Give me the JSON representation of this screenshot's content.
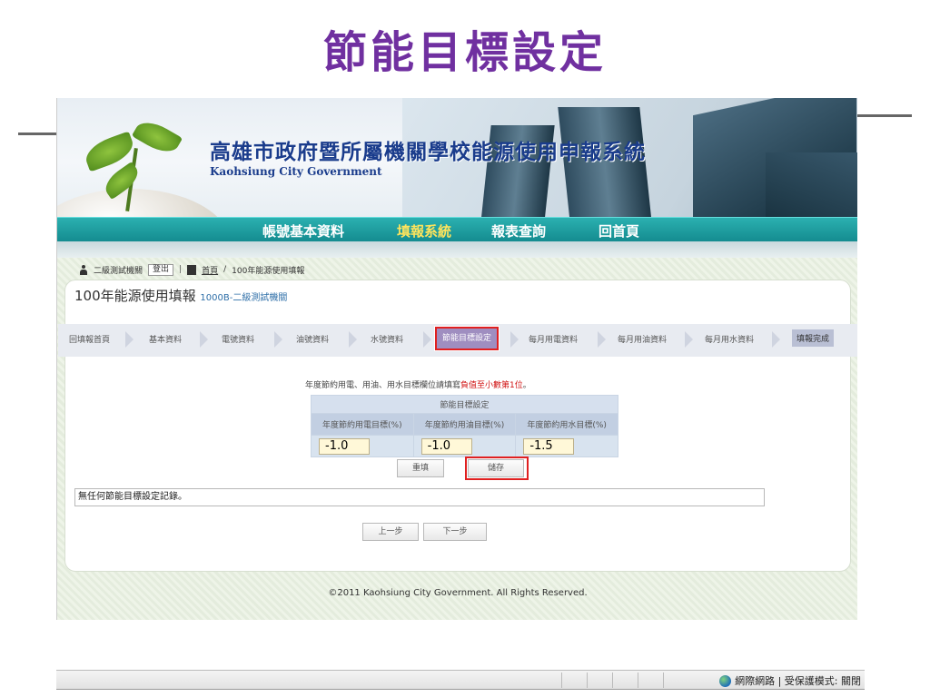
{
  "slide": {
    "title": "節能目標設定"
  },
  "banner": {
    "title": "高雄市政府暨所屬機關學校能源使用申報系統",
    "subtitle": "Kaohsiung City Government"
  },
  "nav": {
    "items": [
      {
        "label": "帳號基本資料"
      },
      {
        "label": "填報系統"
      },
      {
        "label": "報表查詢"
      },
      {
        "label": "回首頁"
      }
    ]
  },
  "userbar": {
    "user": "二級測試機關",
    "logout": "登出",
    "home": "首頁",
    "separator": "/",
    "crumb": "100年能源使用填報"
  },
  "panel": {
    "title": "100年能源使用填報",
    "org": "1000B-二級測試機關"
  },
  "steps": [
    {
      "label": "回填報首頁"
    },
    {
      "label": "基本資料"
    },
    {
      "label": "電號資料"
    },
    {
      "label": "油號資料"
    },
    {
      "label": "水號資料"
    },
    {
      "label": "節能目標設定"
    },
    {
      "label": "每月用電資料"
    },
    {
      "label": "每月用油資料"
    },
    {
      "label": "每月用水資料"
    },
    {
      "label": "填報完成"
    }
  ],
  "hint": {
    "text": "年度節約用電、用油、用水目標欄位請填寫",
    "highlight": "負值至小數第1位",
    "end": "。"
  },
  "table": {
    "caption": "節能目標設定",
    "headers": [
      "年度節約用電目標(%)",
      "年度節約用油目標(%)",
      "年度節約用水目標(%)"
    ],
    "values": [
      "-1.0",
      "-1.0",
      "-1.5"
    ]
  },
  "buttons": {
    "clear": "重填",
    "save": "儲存",
    "prev": "上一步",
    "next": "下一步"
  },
  "record": {
    "text": "無任何節能目標設定記錄。"
  },
  "footer": {
    "text": "©2011 Kaohsiung City Government. All Rights Reserved."
  },
  "statusbar": {
    "text": "網際網路 | 受保護模式: 關閉"
  },
  "colors": {
    "slide_title": "#7030a0",
    "nav_bg": "#148c90",
    "nav_active": "#ffe45c",
    "highlight_border": "#e02020",
    "hint_red": "#d01010"
  }
}
